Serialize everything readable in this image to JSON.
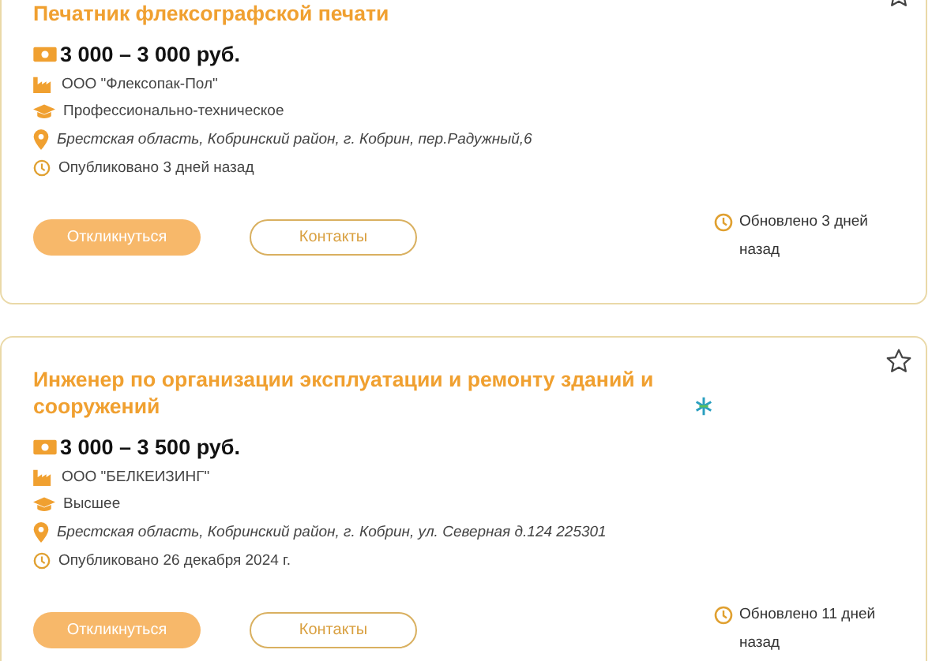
{
  "vacancies": [
    {
      "title": "Печатник флексографской печати",
      "has_badge_icon": false,
      "salary": "3 000 – 3 000 руб.",
      "company": "ООО \"Флексопак-Пол\"",
      "education": "Профессионально-техническое",
      "location": "Брестская область, Кобринский район, г. Кобрин, пер.Радужный,6",
      "published": "Опубликовано 3 дней назад",
      "respond_button": "Откликнуться",
      "contacts_button": "Контакты",
      "updated": "Обновлено 3 дней назад"
    },
    {
      "title": "Инженер по организации эксплуатации и ремонту зданий и сооружений",
      "has_badge_icon": true,
      "salary": "3 000 – 3 500 руб.",
      "company": "ООО \"БЕЛКЕИЗИНГ\"",
      "education": "Высшее",
      "location": "Брестская область, Кобринский район, г. Кобрин, ул. Северная д.124 225301",
      "published": "Опубликовано 26 декабря 2024 г.",
      "respond_button": "Откликнуться",
      "contacts_button": "Контакты",
      "updated": "Обновлено 11 дней назад"
    }
  ]
}
